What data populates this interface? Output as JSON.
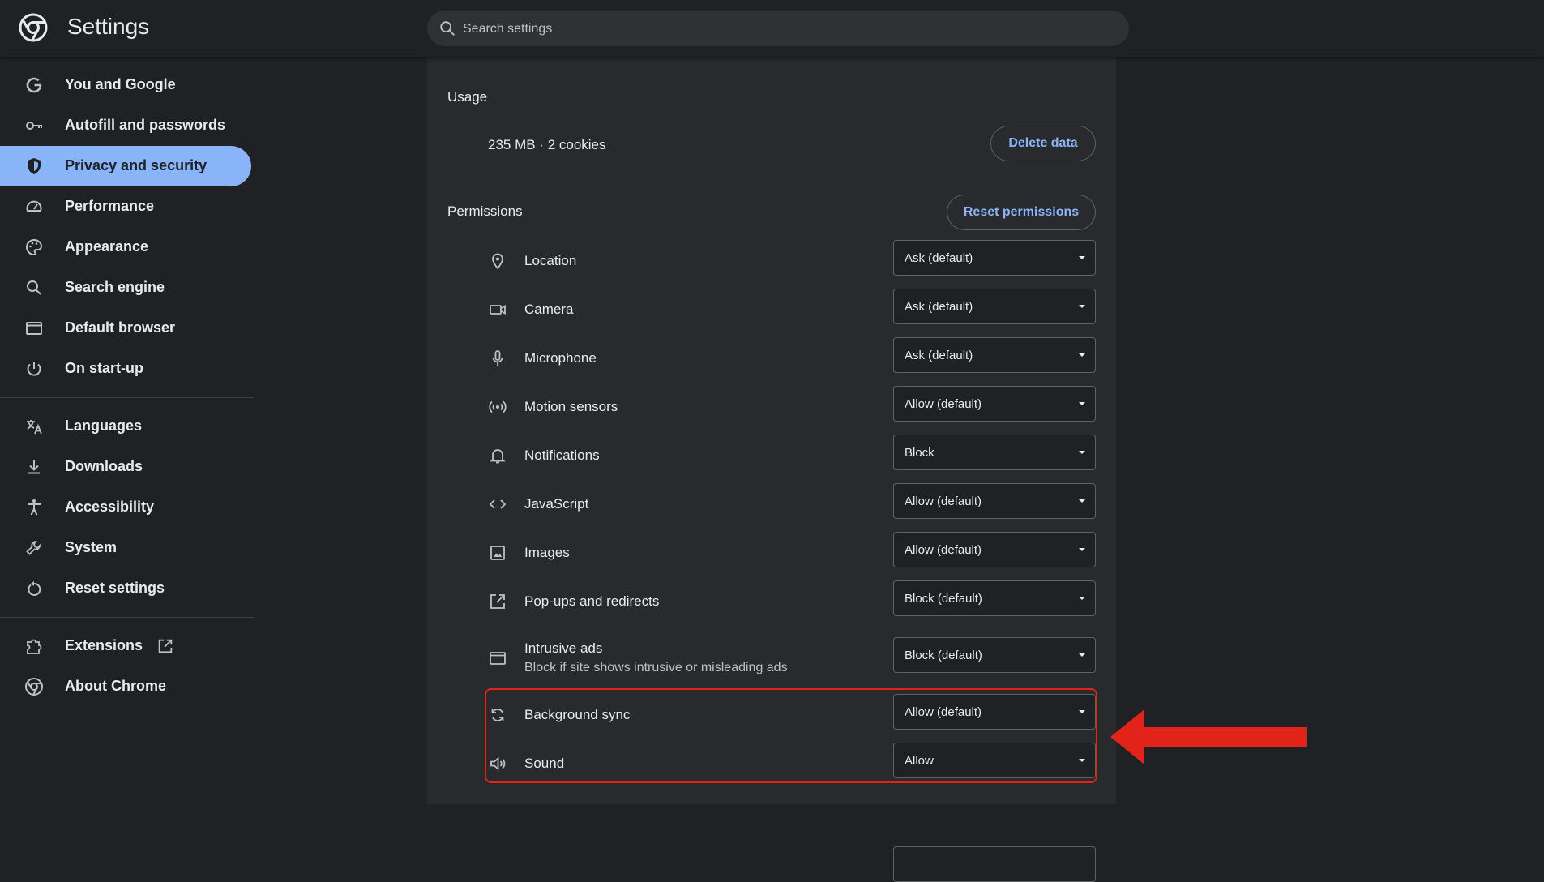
{
  "header": {
    "title": "Settings",
    "search_placeholder": "Search settings"
  },
  "sidebar": {
    "items": [
      {
        "label": "You and Google",
        "icon": "google-g-icon"
      },
      {
        "label": "Autofill and passwords",
        "icon": "key-icon"
      },
      {
        "label": "Privacy and security",
        "icon": "shield-icon",
        "active": true
      },
      {
        "label": "Performance",
        "icon": "speedometer-icon"
      },
      {
        "label": "Appearance",
        "icon": "palette-icon"
      },
      {
        "label": "Search engine",
        "icon": "search-icon"
      },
      {
        "label": "Default browser",
        "icon": "browser-window-icon"
      },
      {
        "label": "On start-up",
        "icon": "power-icon"
      },
      {
        "label": "Languages",
        "icon": "translate-icon"
      },
      {
        "label": "Downloads",
        "icon": "download-icon"
      },
      {
        "label": "Accessibility",
        "icon": "accessibility-icon"
      },
      {
        "label": "System",
        "icon": "wrench-icon"
      },
      {
        "label": "Reset settings",
        "icon": "reset-icon"
      },
      {
        "label": "Extensions",
        "icon": "puzzle-icon"
      },
      {
        "label": "About Chrome",
        "icon": "chrome-icon"
      }
    ]
  },
  "usage": {
    "title": "Usage",
    "summary": "235 MB · 2 cookies",
    "delete_label": "Delete data"
  },
  "permissions": {
    "title": "Permissions",
    "reset_label": "Reset permissions",
    "rows": [
      {
        "label": "Location",
        "value": "Ask (default)",
        "icon": "location-pin-icon"
      },
      {
        "label": "Camera",
        "value": "Ask (default)",
        "icon": "camera-icon"
      },
      {
        "label": "Microphone",
        "value": "Ask (default)",
        "icon": "microphone-icon"
      },
      {
        "label": "Motion sensors",
        "value": "Allow (default)",
        "icon": "motion-sensor-icon"
      },
      {
        "label": "Notifications",
        "value": "Block",
        "icon": "bell-icon"
      },
      {
        "label": "JavaScript",
        "value": "Allow (default)",
        "icon": "code-icon"
      },
      {
        "label": "Images",
        "value": "Allow (default)",
        "icon": "image-icon"
      },
      {
        "label": "Pop-ups and redirects",
        "value": "Block (default)",
        "icon": "open-in-new-icon"
      },
      {
        "label": "Intrusive ads",
        "sublabel": "Block if site shows intrusive or misleading ads",
        "value": "Block (default)",
        "icon": "ads-window-icon"
      },
      {
        "label": "Background sync",
        "value": "Allow (default)",
        "icon": "sync-icon"
      },
      {
        "label": "Sound",
        "value": "Allow",
        "icon": "speaker-icon"
      }
    ]
  },
  "colors": {
    "background": "#202124",
    "card": "#292a2d",
    "accent": "#8ab4f8",
    "annotation_red": "#e2231a"
  }
}
